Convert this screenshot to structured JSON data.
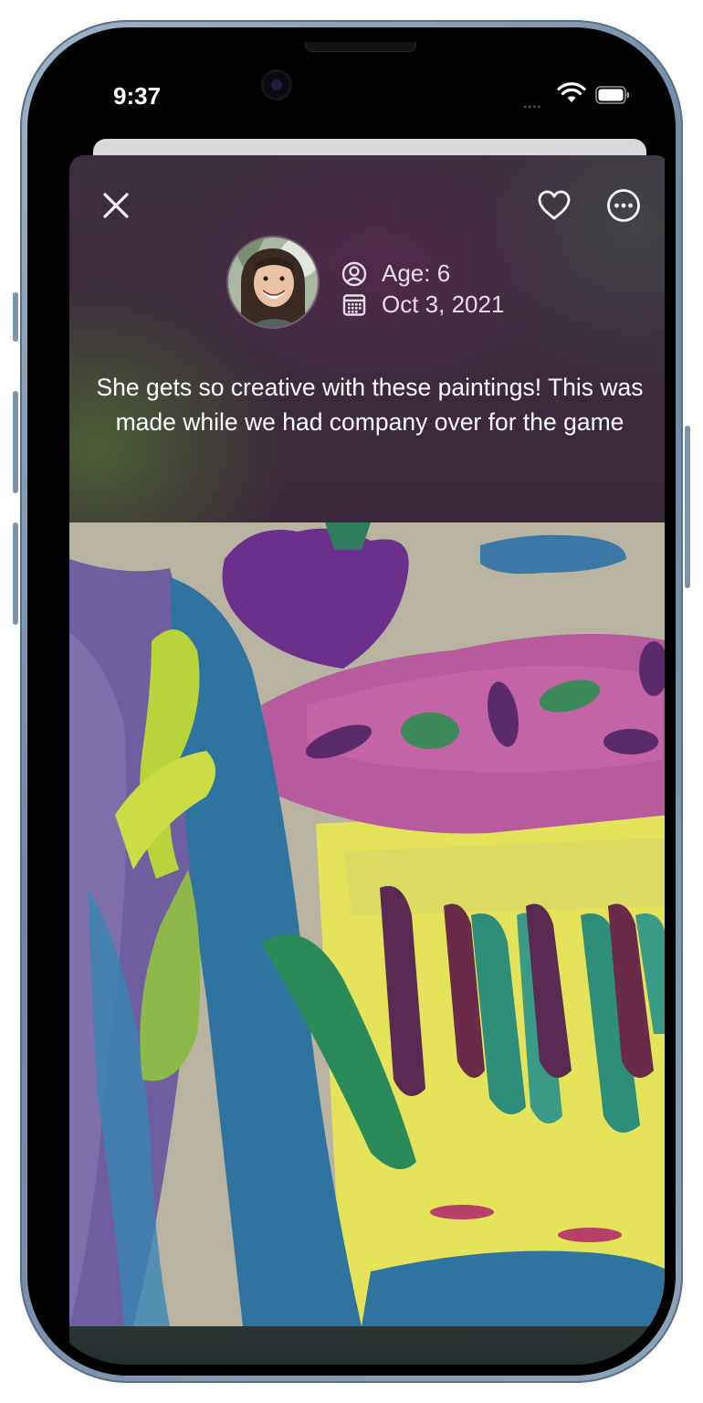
{
  "status_bar": {
    "time": "9:37",
    "signal_dots": "....",
    "wifi_icon": "wifi-icon",
    "battery_icon": "battery-icon"
  },
  "toolbar": {
    "close_icon": "close-icon",
    "like_icon": "heart-icon",
    "more_icon": "ellipsis-circle-icon"
  },
  "profile": {
    "avatar_alt": "child-avatar",
    "age_icon": "person-circle-icon",
    "age": "Age: 6",
    "date_icon": "calendar-icon",
    "date": "Oct 3, 2021"
  },
  "post": {
    "caption": "She gets so creative with these paintings! This was made while we had company over for the game",
    "image": "child-painting-artwork"
  },
  "colors": {
    "sheet_background": "#3b2539",
    "text_primary": "#ffffff",
    "text_secondary": "#e6dde6"
  }
}
